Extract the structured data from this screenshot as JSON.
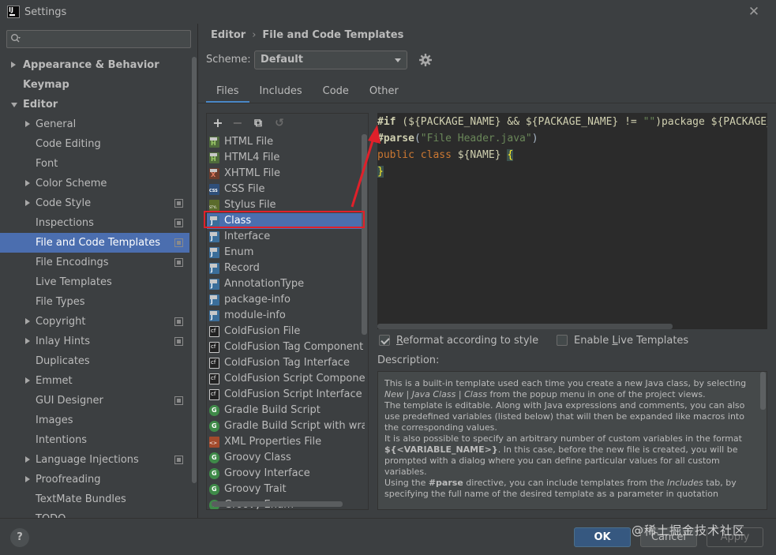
{
  "window": {
    "title": "Settings",
    "close_glyph": "✕"
  },
  "search": {
    "placeholder": ""
  },
  "sidebar": {
    "items": [
      {
        "label": "Appearance & Behavior",
        "bold": true,
        "arrow": "right",
        "indent": 0
      },
      {
        "label": "Keymap",
        "bold": true,
        "arrow": "",
        "indent": 0
      },
      {
        "label": "Editor",
        "bold": true,
        "arrow": "down",
        "indent": 0
      },
      {
        "label": "General",
        "arrow": "right",
        "indent": 1
      },
      {
        "label": "Code Editing",
        "arrow": "",
        "indent": 1
      },
      {
        "label": "Font",
        "arrow": "",
        "indent": 1
      },
      {
        "label": "Color Scheme",
        "arrow": "right",
        "indent": 1
      },
      {
        "label": "Code Style",
        "arrow": "right",
        "indent": 1,
        "project": true
      },
      {
        "label": "Inspections",
        "arrow": "",
        "indent": 1,
        "project": true
      },
      {
        "label": "File and Code Templates",
        "arrow": "",
        "indent": 1,
        "project": true,
        "selected": true
      },
      {
        "label": "File Encodings",
        "arrow": "",
        "indent": 1,
        "project": true
      },
      {
        "label": "Live Templates",
        "arrow": "",
        "indent": 1
      },
      {
        "label": "File Types",
        "arrow": "",
        "indent": 1
      },
      {
        "label": "Copyright",
        "arrow": "right",
        "indent": 1,
        "project": true
      },
      {
        "label": "Inlay Hints",
        "arrow": "right",
        "indent": 1,
        "project": true
      },
      {
        "label": "Duplicates",
        "arrow": "",
        "indent": 1
      },
      {
        "label": "Emmet",
        "arrow": "right",
        "indent": 1
      },
      {
        "label": "GUI Designer",
        "arrow": "",
        "indent": 1,
        "project": true
      },
      {
        "label": "Images",
        "arrow": "",
        "indent": 1
      },
      {
        "label": "Intentions",
        "arrow": "",
        "indent": 1
      },
      {
        "label": "Language Injections",
        "arrow": "right",
        "indent": 1,
        "project": true
      },
      {
        "label": "Proofreading",
        "arrow": "right",
        "indent": 1
      },
      {
        "label": "TextMate Bundles",
        "arrow": "",
        "indent": 1
      },
      {
        "label": "TODO",
        "arrow": "",
        "indent": 1
      }
    ]
  },
  "header": {
    "breadcrumb_parent": "Editor",
    "breadcrumb_sep": "›",
    "breadcrumb_current": "File and Code Templates",
    "scheme_label": "Scheme:",
    "scheme_value": "Default"
  },
  "tabs": [
    {
      "label": "Files",
      "active": true
    },
    {
      "label": "Includes"
    },
    {
      "label": "Code"
    },
    {
      "label": "Other"
    }
  ],
  "toolbar": {
    "add_glyph": "+",
    "remove_glyph": "−",
    "copy_glyph": "⧉",
    "reset_glyph": "↺"
  },
  "templates": [
    {
      "label": "HTML File",
      "icon": "html"
    },
    {
      "label": "HTML4 File",
      "icon": "html"
    },
    {
      "label": "XHTML File",
      "icon": "xhtml"
    },
    {
      "label": "CSS File",
      "icon": "css"
    },
    {
      "label": "Stylus File",
      "icon": "styl"
    },
    {
      "label": "Class",
      "icon": "java",
      "selected": true
    },
    {
      "label": "Interface",
      "icon": "java"
    },
    {
      "label": "Enum",
      "icon": "java"
    },
    {
      "label": "Record",
      "icon": "java"
    },
    {
      "label": "AnnotationType",
      "icon": "java"
    },
    {
      "label": "package-info",
      "icon": "java"
    },
    {
      "label": "module-info",
      "icon": "java"
    },
    {
      "label": "ColdFusion File",
      "icon": "cf"
    },
    {
      "label": "ColdFusion Tag Component",
      "icon": "cf"
    },
    {
      "label": "ColdFusion Tag Interface",
      "icon": "cf"
    },
    {
      "label": "ColdFusion Script Component",
      "icon": "cf"
    },
    {
      "label": "ColdFusion Script Interface",
      "icon": "cf"
    },
    {
      "label": "Gradle Build Script",
      "icon": "gradle"
    },
    {
      "label": "Gradle Build Script with wrappe",
      "icon": "gradle"
    },
    {
      "label": "XML Properties File",
      "icon": "xml"
    },
    {
      "label": "Groovy Class",
      "icon": "gradle"
    },
    {
      "label": "Groovy Interface",
      "icon": "gradle"
    },
    {
      "label": "Groovy Trait",
      "icon": "gradle"
    },
    {
      "label": "Groovy Enum",
      "icon": "gradle"
    }
  ],
  "code": {
    "line1": {
      "a": "#if",
      "b": " (${PACKAGE_NAME} && ${PACKAGE_NAME} != ",
      "c": "\"\"",
      "d": ")package ${PACKAGE_NAME};#end"
    },
    "line2": {
      "a": "#parse",
      "b": "(",
      "c": "\"File Header.java\"",
      "d": ")"
    },
    "line3": {
      "a": "public class",
      "b": " ${NAME} ",
      "c": "{"
    },
    "line4": {
      "a": "}"
    }
  },
  "options": {
    "reformat_prefix": "",
    "reformat_u": "R",
    "reformat_rest": "eformat according to style",
    "reformat_checked": true,
    "live_prefix": "Enable ",
    "live_u": "L",
    "live_rest": "ive Templates",
    "live_checked": false
  },
  "description": {
    "label": "Description:",
    "p1a": "This is a built-in template used each time you create a new Java class, by selecting ",
    "p1b": "New | Java Class | Class",
    "p1c": " from the popup menu in one of the project views.",
    "p2": "The template is editable. Along with Java expressions and comments, you can also use predefined variables (listed below) that will then be expanded like macros into the corresponding values.",
    "p3a": "It is also possible to specify an arbitrary number of custom variables in the format ",
    "p3b": "${<VARIABLE_NAME>}",
    "p3c": ". In this case, before the new file is created, you will be prompted with a dialog where you can define particular values for all custom variables.",
    "p4a": "Using the ",
    "p4b": "#parse",
    "p4c": " directive, you can include templates from the ",
    "p4d": "Includes",
    "p4e": " tab, by specifying the full name of the desired template as a parameter in quotation"
  },
  "footer": {
    "help": "?",
    "ok": "OK",
    "cancel": "Cancel",
    "apply": "Apply",
    "watermark": "@稀土掘金技术社区"
  },
  "colors": {
    "selection": "#4b6eaf",
    "accent_tab": "#4a88c7",
    "annotation_red": "#e0202a"
  }
}
